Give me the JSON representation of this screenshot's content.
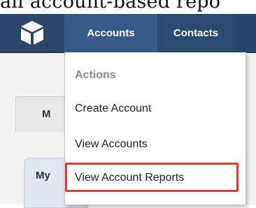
{
  "caption": "ail account-based repo",
  "navbar": {
    "logo_icon": "cube-icon",
    "tabs": [
      "Accounts",
      "Contacts"
    ]
  },
  "background": {
    "tab1_label": "M",
    "tab2_label": "My"
  },
  "menu": {
    "header": "Actions",
    "items": [
      "Create Account",
      "View Accounts",
      "View Account Reports"
    ],
    "highlighted_item": "View Account Reports",
    "highlight_color": "#e53b2c"
  }
}
